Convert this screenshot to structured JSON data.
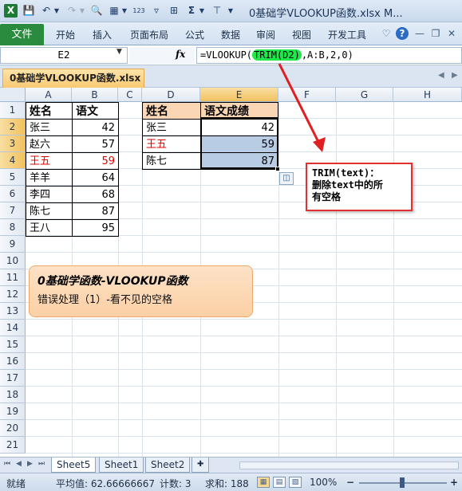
{
  "titlebar": {
    "title": "0基础学VLOOKUP函数.xlsx M...",
    "app_icon": "X"
  },
  "ribbon": {
    "file_tab": "文件",
    "tabs": [
      "开始",
      "插入",
      "页面布局",
      "公式",
      "数据",
      "审阅",
      "视图",
      "开发工具"
    ]
  },
  "formula_bar": {
    "name_box": "E2",
    "fx_label": "fx",
    "formula_prefix": "=VLOOKUP(",
    "formula_highlight": "TRIM(D2)",
    "formula_suffix": ",A:B,2,0)"
  },
  "workbook_tab": "0基础学VLOOKUP函数.xlsx",
  "grid": {
    "columns": [
      "A",
      "B",
      "C",
      "D",
      "E",
      "F",
      "G",
      "H"
    ],
    "selected_column": "E",
    "rows": [
      "1",
      "2",
      "3",
      "4",
      "5",
      "6",
      "7",
      "8",
      "9",
      "10",
      "11",
      "12",
      "13",
      "14",
      "15",
      "16",
      "17",
      "18",
      "19",
      "20",
      "21"
    ],
    "selected_rows": [
      "2",
      "3",
      "4"
    ],
    "left_table": {
      "headers": [
        "姓名",
        "语文"
      ],
      "rows": [
        {
          "name": "张三",
          "score": "42",
          "red": false
        },
        {
          "name": "赵六",
          "score": "57",
          "red": false
        },
        {
          "name": "王五",
          "score": "59",
          "red": true
        },
        {
          "name": "羊羊",
          "score": "64",
          "red": false
        },
        {
          "name": "李四",
          "score": "68",
          "red": false
        },
        {
          "name": "陈七",
          "score": "87",
          "red": false
        },
        {
          "name": "王八",
          "score": "95",
          "red": false
        }
      ]
    },
    "right_table": {
      "headers": [
        "姓名",
        "语文成绩"
      ],
      "rows": [
        {
          "name": "张三",
          "score": "42",
          "red": false
        },
        {
          "name": "王五",
          "score": "59",
          "red": true
        },
        {
          "name": "陈七",
          "score": "87",
          "red": false
        }
      ]
    }
  },
  "callouts": {
    "orange_title": "0基础学函数-VLOOKUP函数",
    "orange_subtitle": "错误处理（1）-看不见的空格",
    "red_line1": "TRIM(text)：",
    "red_line2": "删除text中的所",
    "red_line3": "有空格"
  },
  "sheet_tabs": [
    "Sheet5",
    "Sheet1",
    "Sheet2"
  ],
  "status_bar": {
    "ready": "就绪",
    "average": "平均值: 62.66666667",
    "count": "计数: 3",
    "sum": "求和: 188",
    "zoom": "100%"
  },
  "colors": {
    "accent_green": "#2a8a3e",
    "highlight_green": "#1fe94a",
    "selection_blue": "#b8cce4",
    "red_text": "#e00000",
    "orange_fill": "#fbd0a6"
  }
}
